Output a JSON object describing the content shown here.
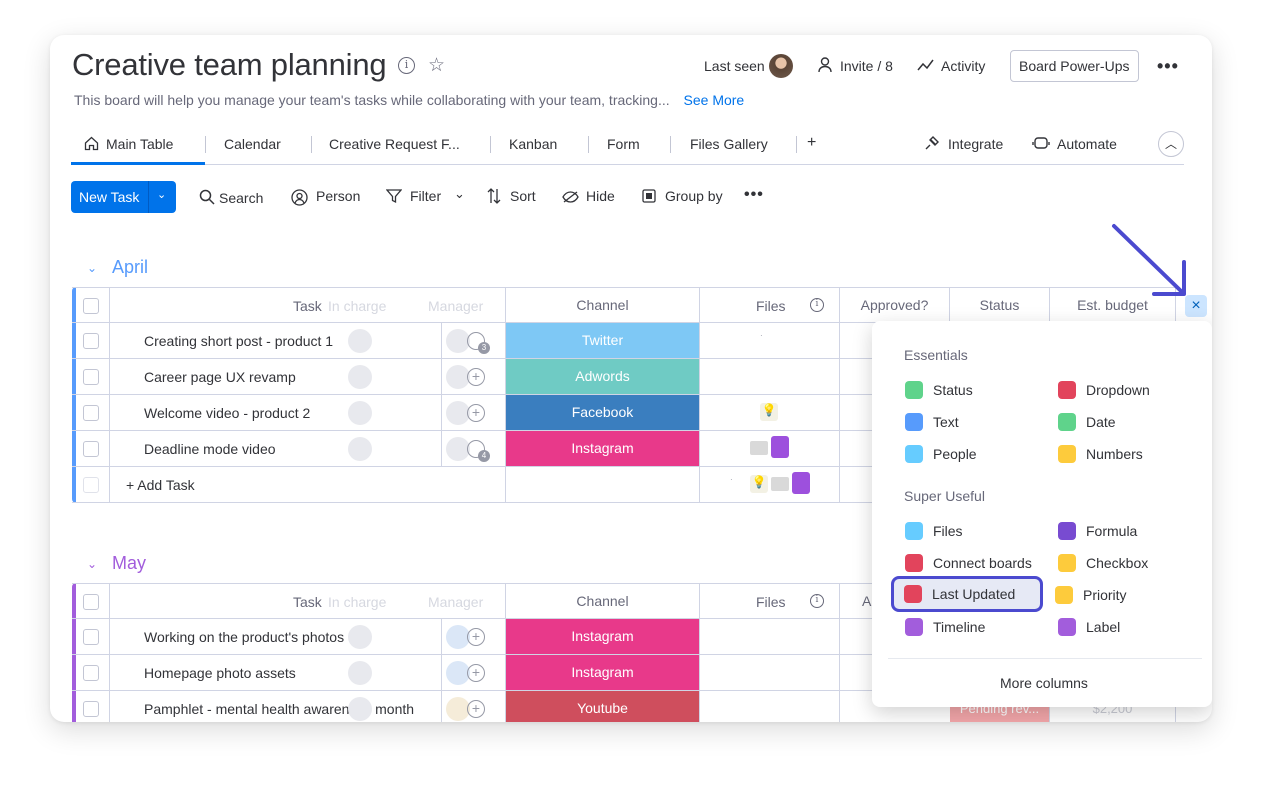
{
  "header": {
    "title": "Creative team planning",
    "description": "This board will help you manage your team's tasks while collaborating with your team, tracking...",
    "see_more": "See More",
    "last_seen": "Last seen",
    "invite": "Invite / 8",
    "activity": "Activity",
    "power_ups": "Board Power-Ups",
    "more": "•••"
  },
  "tabs": [
    {
      "label": "Main Table"
    },
    {
      "label": "Calendar"
    },
    {
      "label": "Creative Request F..."
    },
    {
      "label": "Kanban"
    },
    {
      "label": "Form"
    },
    {
      "label": "Files Gallery"
    },
    {
      "label": "+"
    }
  ],
  "tab_actions": {
    "integrate": "Integrate",
    "automate": "Automate"
  },
  "toolbar": {
    "new_task": "New Task",
    "search": "Search",
    "person": "Person",
    "filter": "Filter",
    "sort": "Sort",
    "hide": "Hide",
    "group_by": "Group by",
    "more": "•••"
  },
  "columns": {
    "task": "Task",
    "in_charge": "In charge",
    "manager": "Manager",
    "channel": "Channel",
    "files": "Files",
    "approved": "Approved?",
    "status": "Status",
    "budget": "Est. budget",
    "approved_short": "A"
  },
  "groups": [
    {
      "name": "April",
      "color": "#579bfc",
      "rows": [
        {
          "task": "Creating short post - product 1",
          "channel": "Twitter",
          "channel_color": "#7ec8f5",
          "manager_count": "3"
        },
        {
          "task": "Career page UX revamp",
          "channel": "Adwords",
          "channel_color": "#6fcbc4"
        },
        {
          "task": "Welcome video - product 2",
          "channel": "Facebook",
          "channel_color": "#3a7ebf"
        },
        {
          "task": "Deadline mode video",
          "channel": "Instagram",
          "channel_color": "#e8398a",
          "manager_count": "4"
        }
      ],
      "add_task": "+ Add Task"
    },
    {
      "name": "May",
      "color": "#a25ddc",
      "rows": [
        {
          "task": "Working on the product's photos",
          "channel": "Instagram",
          "channel_color": "#e8398a"
        },
        {
          "task": "Homepage photo assets",
          "channel": "Instagram",
          "channel_color": "#e8398a"
        },
        {
          "task": "Pamphlet - mental health awareness month",
          "channel": "Youtube",
          "channel_color": "#cf4e5d",
          "status": "Pending rev...",
          "budget": "$2,200"
        }
      ]
    }
  ],
  "column_picker": {
    "essentials_title": "Essentials",
    "essentials": [
      {
        "label": "Status",
        "color": "#5fd38b"
      },
      {
        "label": "Dropdown",
        "color": "#e2445c"
      },
      {
        "label": "Text",
        "color": "#579bfc"
      },
      {
        "label": "Date",
        "color": "#5fd38b"
      },
      {
        "label": "People",
        "color": "#66ccff"
      },
      {
        "label": "Numbers",
        "color": "#fdcb3c"
      }
    ],
    "super_useful_title": "Super Useful",
    "super_useful": [
      {
        "label": "Files",
        "color": "#66ccff"
      },
      {
        "label": "Formula",
        "color": "#784bd1"
      },
      {
        "label": "Connect boards",
        "color": "#e2445c"
      },
      {
        "label": "Checkbox",
        "color": "#fdcb3c"
      },
      {
        "label": "Last Updated",
        "color": "#e2445c"
      },
      {
        "label": "Priority",
        "color": "#fdcb3c"
      },
      {
        "label": "Timeline",
        "color": "#a25ddc"
      },
      {
        "label": "Label",
        "color": "#a25ddc"
      }
    ],
    "more_columns": "More columns",
    "close": "×"
  }
}
